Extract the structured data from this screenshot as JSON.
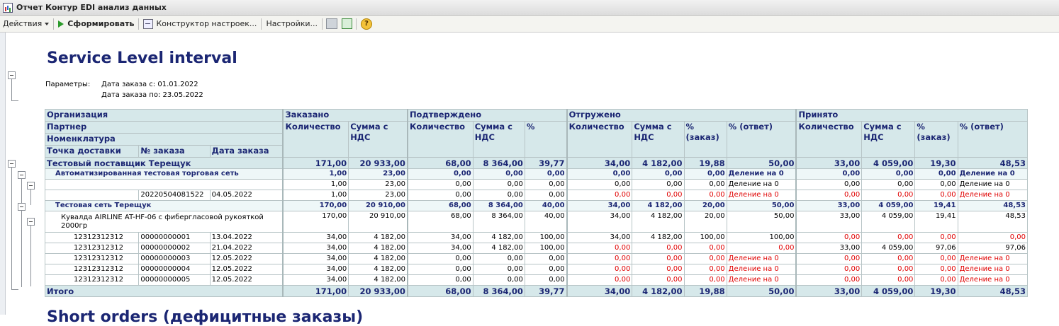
{
  "window": {
    "title": "Отчет  Контур EDI анализ данных"
  },
  "toolbar": {
    "actions": "Действия",
    "generate": "Сформировать",
    "constructor": "Конструктор настроек...",
    "settings": "Настройки...",
    "help": "?"
  },
  "report": {
    "title": "Service Level interval",
    "params_label": "Параметры:",
    "params": [
      "Дата заказа с: 01.01.2022",
      "Дата заказа по: 23.05.2022"
    ],
    "next_title": "Short orders (дефицитные заказы)"
  },
  "table": {
    "groups": {
      "ordered": "Заказано",
      "confirmed": "Подтверждено",
      "shipped": "Отгружено",
      "accepted": "Принято"
    },
    "dims": {
      "org": "Организация",
      "partner": "Партнер",
      "item": "Номенклатура",
      "delivery": "Точка доставки",
      "order_no": "№ заказа",
      "order_date": "Дата заказа"
    },
    "cols": {
      "qty": "Количество",
      "sum": "Сумма с НДС",
      "pct": "%",
      "pct_order": "% (заказ)",
      "pct_answer": "% (ответ)"
    },
    "rows": [
      {
        "type": "lvl0",
        "a": "Тестовый поставщик Терещук",
        "b": "",
        "c": "",
        "v": [
          "171,00",
          "20 933,00",
          "68,00",
          "8 364,00",
          "39,77",
          "34,00",
          "4 182,00",
          "19,88",
          "50,00",
          "33,00",
          "4 059,00",
          "19,30",
          "48,53"
        ]
      },
      {
        "type": "lvl1",
        "a": "Автоматизированная тестовая торговая сеть",
        "b": "",
        "c": "",
        "v": [
          "1,00",
          "23,00",
          "0,00",
          "0,00",
          "0,00",
          "0,00",
          "0,00",
          "0,00",
          "Деление на 0",
          "0,00",
          "0,00",
          "0,00",
          "Деление на 0"
        ]
      },
      {
        "type": "lvl2",
        "a": "",
        "b": "",
        "c": "",
        "v": [
          "1,00",
          "23,00",
          "0,00",
          "0,00",
          "0,00",
          "0,00",
          "0,00",
          "0,00",
          "Деление на 0",
          "0,00",
          "0,00",
          "0,00",
          "Деление на 0"
        ]
      },
      {
        "type": "det",
        "a": "",
        "b": "20220504081522",
        "c": "04.05.2022",
        "v": [
          "1,00",
          "23,00",
          "0,00",
          "0,00",
          "0,00",
          "0,00",
          "0,00",
          "0,00",
          "Деление на 0",
          "0,00",
          "0,00",
          "0,00",
          "Деление на 0"
        ],
        "red": [
          5,
          6,
          7,
          8,
          9,
          10,
          11,
          12
        ]
      },
      {
        "type": "lvl1",
        "a": "Тестовая сеть Терещук",
        "b": "",
        "c": "",
        "v": [
          "170,00",
          "20 910,00",
          "68,00",
          "8 364,00",
          "40,00",
          "34,00",
          "4 182,00",
          "20,00",
          "50,00",
          "33,00",
          "4 059,00",
          "19,41",
          "48,53"
        ]
      },
      {
        "type": "lvl2",
        "a": "Кувалда AIRLINE AT-HF-06  с фибергласовой рукояткой 2000гр",
        "b": "",
        "c": "",
        "v": [
          "170,00",
          "20 910,00",
          "68,00",
          "8 364,00",
          "40,00",
          "34,00",
          "4 182,00",
          "20,00",
          "50,00",
          "33,00",
          "4 059,00",
          "19,41",
          "48,53"
        ],
        "tall": true
      },
      {
        "type": "det",
        "a": "12312312312",
        "b": "00000000001",
        "c": "13.04.2022",
        "v": [
          "34,00",
          "4 182,00",
          "34,00",
          "4 182,00",
          "100,00",
          "34,00",
          "4 182,00",
          "100,00",
          "100,00",
          "0,00",
          "0,00",
          "0,00",
          "0,00"
        ],
        "red": [
          9,
          10,
          11,
          12
        ]
      },
      {
        "type": "det",
        "a": "12312312312",
        "b": "00000000002",
        "c": "21.04.2022",
        "v": [
          "34,00",
          "4 182,00",
          "34,00",
          "4 182,00",
          "100,00",
          "0,00",
          "0,00",
          "0,00",
          "0,00",
          "33,00",
          "4 059,00",
          "97,06",
          "97,06"
        ],
        "red": [
          5,
          6,
          7,
          8
        ]
      },
      {
        "type": "det",
        "a": "12312312312",
        "b": "00000000003",
        "c": "12.05.2022",
        "v": [
          "34,00",
          "4 182,00",
          "0,00",
          "0,00",
          "0,00",
          "0,00",
          "0,00",
          "0,00",
          "Деление на 0",
          "0,00",
          "0,00",
          "0,00",
          "Деление на 0"
        ],
        "red": [
          5,
          6,
          7,
          8,
          9,
          10,
          11,
          12
        ]
      },
      {
        "type": "det",
        "a": "12312312312",
        "b": "00000000004",
        "c": "12.05.2022",
        "v": [
          "34,00",
          "4 182,00",
          "0,00",
          "0,00",
          "0,00",
          "0,00",
          "0,00",
          "0,00",
          "Деление на 0",
          "0,00",
          "0,00",
          "0,00",
          "Деление на 0"
        ],
        "red": [
          5,
          6,
          7,
          8,
          9,
          10,
          11,
          12
        ]
      },
      {
        "type": "det",
        "a": "12312312312",
        "b": "00000000005",
        "c": "12.05.2022",
        "v": [
          "34,00",
          "4 182,00",
          "0,00",
          "0,00",
          "0,00",
          "0,00",
          "0,00",
          "0,00",
          "Деление на 0",
          "0,00",
          "0,00",
          "0,00",
          "Деление на 0"
        ],
        "red": [
          5,
          6,
          7,
          8,
          9,
          10,
          11,
          12
        ]
      },
      {
        "type": "total",
        "a": "Итого",
        "b": "",
        "c": "",
        "v": [
          "171,00",
          "20 933,00",
          "68,00",
          "8 364,00",
          "39,77",
          "34,00",
          "4 182,00",
          "19,88",
          "50,00",
          "33,00",
          "4 059,00",
          "19,30",
          "48,53"
        ]
      }
    ]
  }
}
